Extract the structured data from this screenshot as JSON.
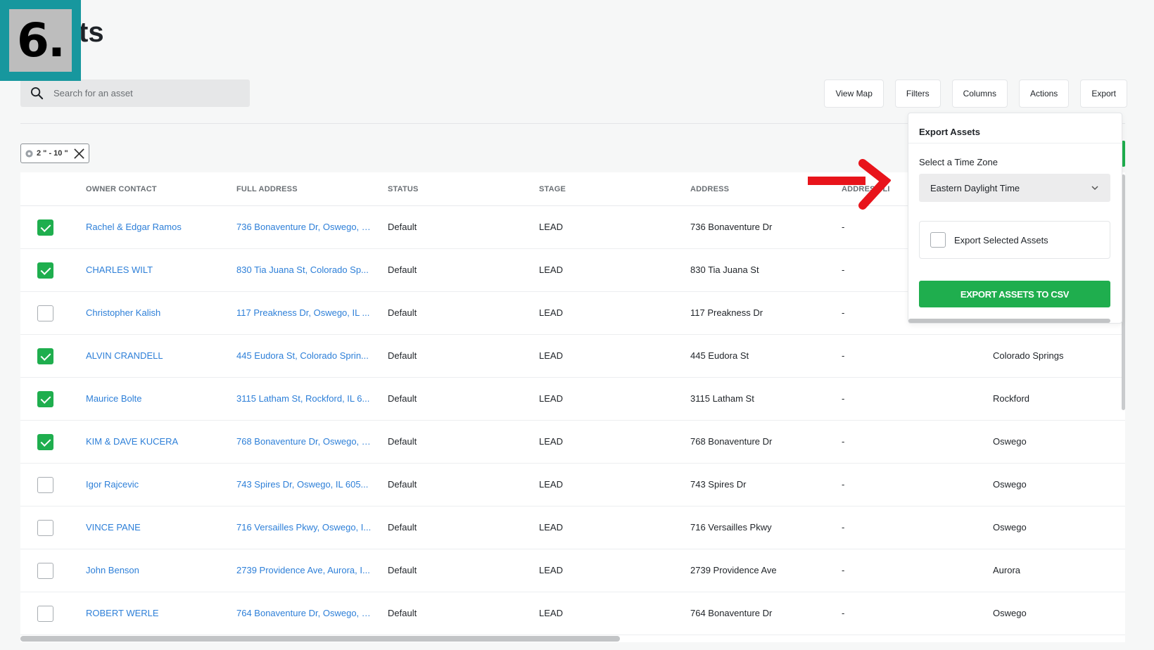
{
  "step": {
    "number": "6."
  },
  "page": {
    "title_visible": "ts"
  },
  "search": {
    "placeholder": "Search for an asset"
  },
  "toolbar": {
    "view_map": "View Map",
    "filters": "Filters",
    "columns": "Columns",
    "actions": "Actions",
    "export": "Export"
  },
  "filter_chip": {
    "label": "2 \" - 10 \""
  },
  "table": {
    "headers": {
      "owner_contact": "OWNER CONTACT",
      "full_address": "FULL ADDRESS",
      "status": "STATUS",
      "stage": "STAGE",
      "address": "ADDRESS",
      "address_2": "ADDRESS LI"
    },
    "rows": [
      {
        "checked": true,
        "owner": "Rachel & Edgar Ramos",
        "full_address": "736 Bonaventure Dr, Oswego, I...",
        "status": "Default",
        "stage": "LEAD",
        "address": "736 Bonaventure Dr",
        "address_2": "-",
        "city": ""
      },
      {
        "checked": true,
        "owner": "CHARLES WILT",
        "full_address": "830 Tia Juana St, Colorado Sp...",
        "status": "Default",
        "stage": "LEAD",
        "address": "830 Tia Juana St",
        "address_2": "-",
        "city": ""
      },
      {
        "checked": false,
        "owner": "Christopher Kalish",
        "full_address": "117 Preakness Dr, Oswego, IL ...",
        "status": "Default",
        "stage": "LEAD",
        "address": "117 Preakness Dr",
        "address_2": "-",
        "city": ""
      },
      {
        "checked": true,
        "owner": "ALVIN CRANDELL",
        "full_address": "445 Eudora St, Colorado Sprin...",
        "status": "Default",
        "stage": "LEAD",
        "address": "445 Eudora St",
        "address_2": "-",
        "city": "Colorado Springs"
      },
      {
        "checked": true,
        "owner": "Maurice Bolte",
        "full_address": "3115 Latham St, Rockford, IL 6...",
        "status": "Default",
        "stage": "LEAD",
        "address": "3115 Latham St",
        "address_2": "-",
        "city": "Rockford"
      },
      {
        "checked": true,
        "owner": "KIM & DAVE KUCERA",
        "full_address": "768 Bonaventure Dr, Oswego, I...",
        "status": "Default",
        "stage": "LEAD",
        "address": "768 Bonaventure Dr",
        "address_2": "-",
        "city": "Oswego"
      },
      {
        "checked": false,
        "owner": "Igor Rajcevic",
        "full_address": "743 Spires Dr, Oswego, IL 605...",
        "status": "Default",
        "stage": "LEAD",
        "address": "743 Spires Dr",
        "address_2": "-",
        "city": "Oswego"
      },
      {
        "checked": false,
        "owner": "VINCE PANE",
        "full_address": "716 Versailles Pkwy, Oswego, I...",
        "status": "Default",
        "stage": "LEAD",
        "address": "716 Versailles Pkwy",
        "address_2": "-",
        "city": "Oswego"
      },
      {
        "checked": false,
        "owner": "John Benson",
        "full_address": "2739 Providence Ave, Aurora, I...",
        "status": "Default",
        "stage": "LEAD",
        "address": "2739 Providence Ave",
        "address_2": "-",
        "city": "Aurora"
      },
      {
        "checked": false,
        "owner": "ROBERT WERLE",
        "full_address": "764 Bonaventure Dr, Oswego, I...",
        "status": "Default",
        "stage": "LEAD",
        "address": "764 Bonaventure Dr",
        "address_2": "-",
        "city": "Oswego"
      }
    ]
  },
  "export_panel": {
    "title": "Export Assets",
    "timezone_label": "Select a Time Zone",
    "timezone_value": "Eastern Daylight Time",
    "selected_label": "Export Selected Assets",
    "button_label": "EXPORT ASSETS TO CSV"
  },
  "colors": {
    "accent_green": "#1fae4e",
    "link_blue": "#2d7fd8",
    "badge_teal": "#17979e",
    "arrow_red": "#e8141b"
  },
  "icons": {
    "search": "search-icon",
    "chip": "gear-icon",
    "close": "close-icon",
    "chevron": "chevron-down-icon"
  }
}
